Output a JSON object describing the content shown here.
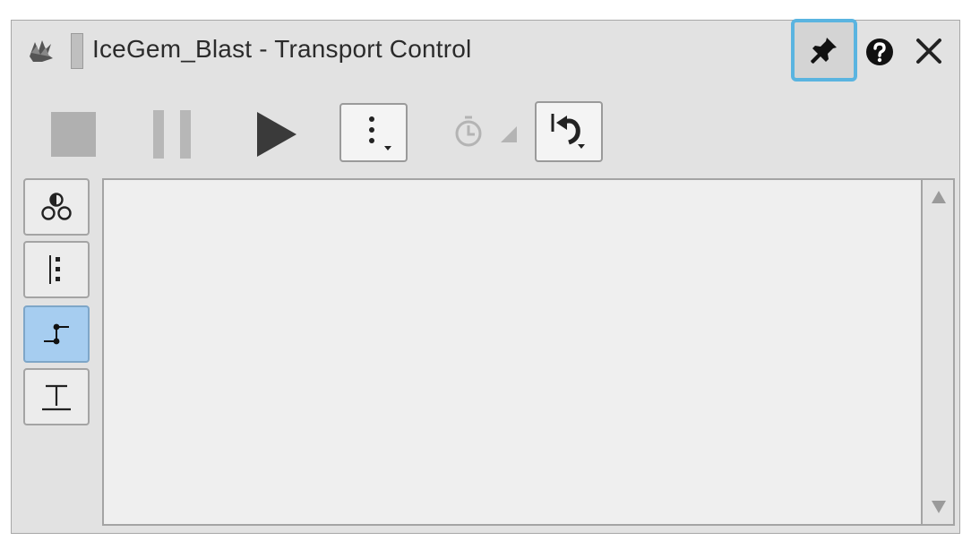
{
  "window": {
    "title": "IceGem_Blast - Transport Control",
    "accent_color": "#5ab4e0"
  },
  "titlebar": {
    "icons": [
      "app-icon",
      "pin-icon",
      "help-icon",
      "close-icon"
    ]
  },
  "toolbar": {
    "buttons": [
      "stop",
      "pause",
      "play",
      "options-menu",
      "time-mode",
      "rewind"
    ]
  },
  "sidebar": {
    "buttons": [
      {
        "name": "particle-view",
        "active": false
      },
      {
        "name": "timeline-view",
        "active": false
      },
      {
        "name": "curve-view",
        "active": true
      },
      {
        "name": "range-view",
        "active": false
      }
    ]
  }
}
